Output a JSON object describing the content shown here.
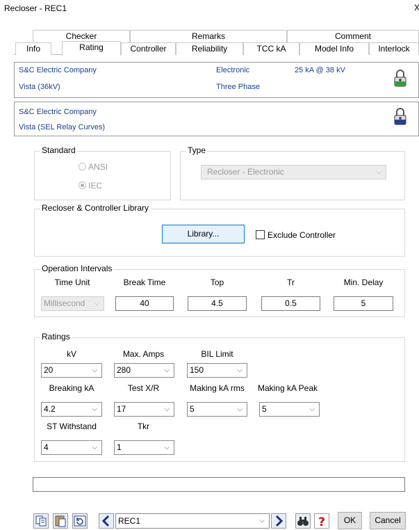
{
  "window": {
    "title": "Recloser - REC1",
    "close": "X"
  },
  "tabs_top": [
    "Checker",
    "Remarks",
    "Comment"
  ],
  "tabs_bottom": [
    "Info",
    "Rating",
    "Controller",
    "Reliability",
    "TCC kA",
    "Model Info",
    "Interlock"
  ],
  "info1": {
    "manufacturer": "S&C Electric Company",
    "model": "Vista (36kV)",
    "kind": "Electronic",
    "phase": "Three Phase",
    "rating": "25 kA @ 38 kV"
  },
  "info2": {
    "manufacturer": "S&C Electric Company",
    "model": "Vista (SEL Relay Curves)"
  },
  "standard": {
    "legend": "Standard",
    "ansi": "ANSI",
    "iec": "IEC",
    "selected": "IEC"
  },
  "type": {
    "legend": "Type",
    "value": "Recloser - Electronic"
  },
  "library": {
    "legend": "Recloser & Controller Library",
    "button": "Library...",
    "exclude": "Exclude Controller"
  },
  "intervals": {
    "legend": "Operation Intervals",
    "labels": {
      "unit": "Time Unit",
      "break": "Break Time",
      "top": "Top",
      "tr": "Tr",
      "min": "Min. Delay"
    },
    "values": {
      "unit": "Millisecond",
      "break": "40",
      "top": "4.5",
      "tr": "0.5",
      "min": "5"
    }
  },
  "ratings": {
    "legend": "Ratings",
    "labels": {
      "kv": "kV",
      "maxamps": "Max. Amps",
      "bil": "BIL Limit",
      "breaking": "Breaking kA",
      "testxr": "Test X/R",
      "makingrms": "Making kA rms",
      "makingpeak": "Making kA Peak",
      "st": "ST Withstand",
      "tkr": "Tkr"
    },
    "values": {
      "kv": "20",
      "maxamps": "280",
      "bil": "150",
      "breaking": "4.2",
      "testxr": "17",
      "makingrms": "5",
      "makingpeak": "5",
      "st": "4",
      "tkr": "1"
    }
  },
  "bottom": {
    "id": "REC1",
    "ok": "OK",
    "cancel": "Cancel"
  }
}
